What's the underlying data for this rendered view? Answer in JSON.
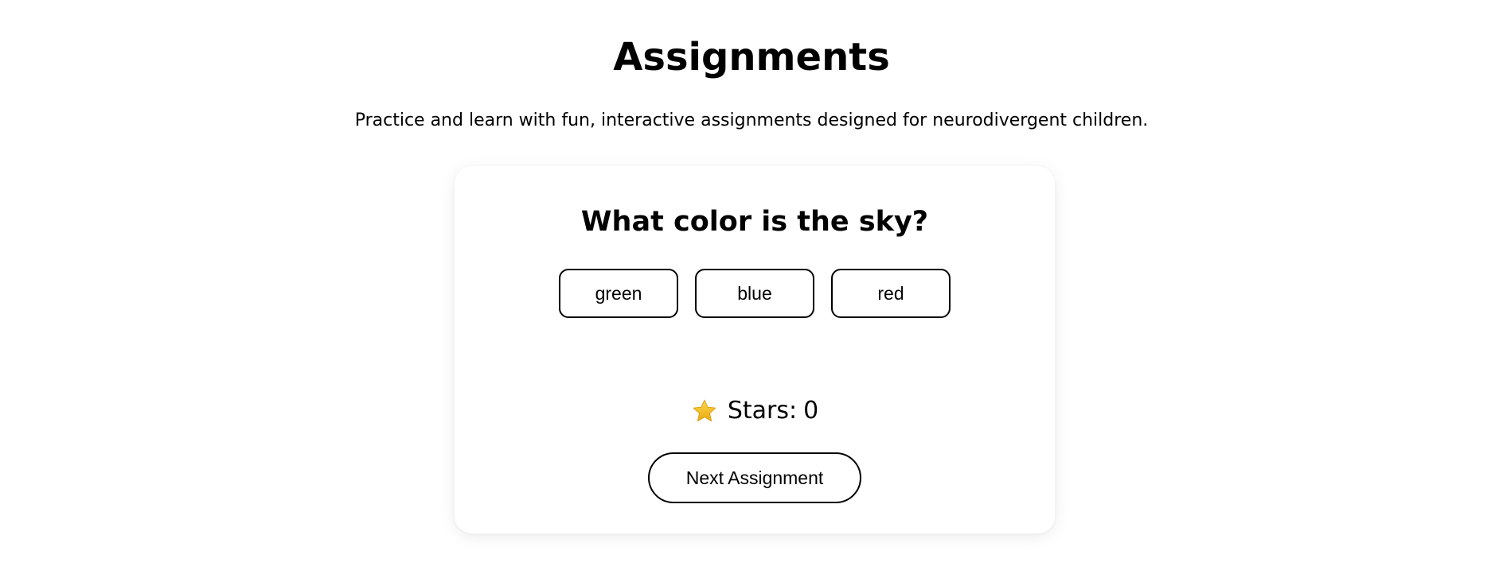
{
  "header": {
    "title": "Assignments",
    "subtitle": "Practice and learn with fun, interactive assignments designed for neurodivergent children."
  },
  "assignment": {
    "question": "What color is the sky?",
    "options": [
      "green",
      "blue",
      "red"
    ],
    "stars_label": "Stars:",
    "stars_count": "0",
    "star_icon": "star-icon",
    "next_label": "Next Assignment"
  },
  "colors": {
    "star": "#f5c022",
    "border": "#000000",
    "background": "#ffffff"
  }
}
